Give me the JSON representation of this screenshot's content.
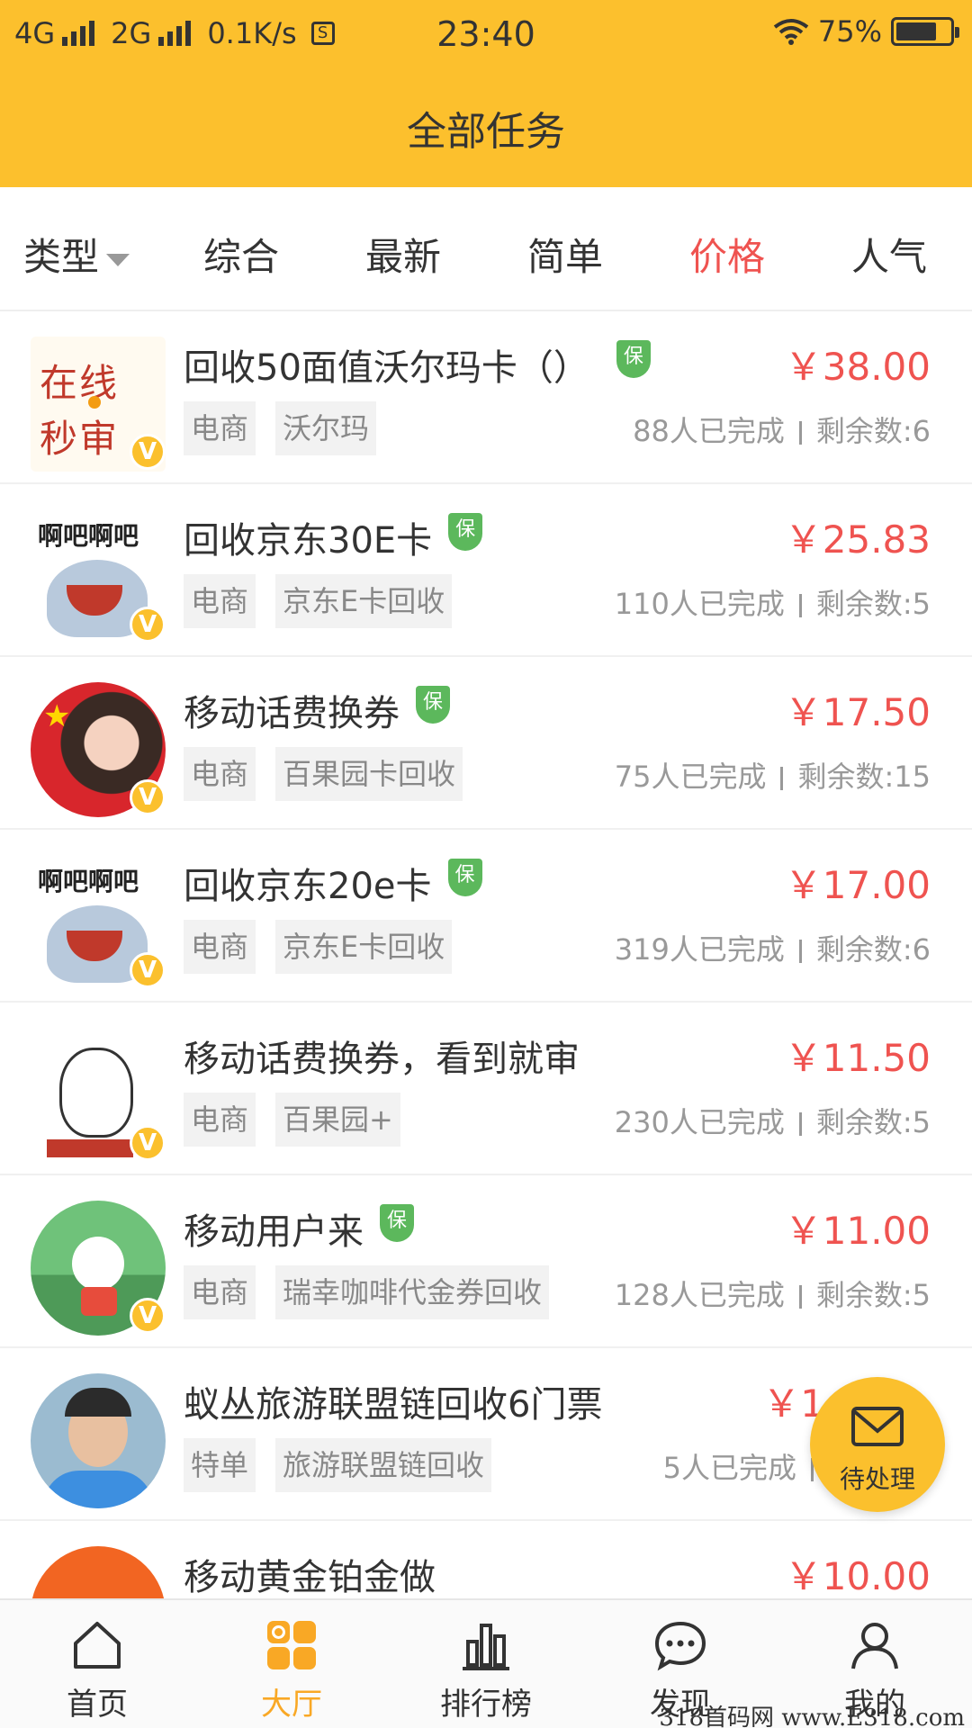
{
  "status_bar": {
    "net1": "4G",
    "net2": "2G",
    "speed": "0.1K/s",
    "time": "23:40",
    "battery": "75%",
    "battery_level": 0.75
  },
  "header": {
    "title": "全部任务"
  },
  "tabs": [
    {
      "label": "类型",
      "active": false
    },
    {
      "label": "综合",
      "active": false
    },
    {
      "label": "最新",
      "active": false
    },
    {
      "label": "简单",
      "active": false
    },
    {
      "label": "价格",
      "active": true
    },
    {
      "label": "人气",
      "active": false
    }
  ],
  "tasks": [
    {
      "title": "回收50面值沃尔玛卡（）",
      "guarantee": true,
      "price": "￥38.00",
      "tags": [
        "电商",
        "沃尔玛"
      ],
      "completed": "88人已完成",
      "remaining": "剩余数:6",
      "avatar_text": "在线秒审"
    },
    {
      "title": "回收京东30E卡",
      "guarantee": true,
      "price": "￥25.83",
      "tags": [
        "电商",
        "京东E卡回收"
      ],
      "completed": "110人已完成",
      "remaining": "剩余数:5",
      "avatar_text": "啊吧啊吧"
    },
    {
      "title": "移动话费换券",
      "guarantee": true,
      "price": "￥17.50",
      "tags": [
        "电商",
        "百果园卡回收"
      ],
      "completed": "75人已完成",
      "remaining": "剩余数:15",
      "avatar_text": ""
    },
    {
      "title": "回收京东20e卡",
      "guarantee": true,
      "price": "￥17.00",
      "tags": [
        "电商",
        "京东E卡回收"
      ],
      "completed": "319人已完成",
      "remaining": "剩余数:6",
      "avatar_text": "啊吧啊吧"
    },
    {
      "title": "移动话费换券，看到就审",
      "guarantee": false,
      "price": "￥11.50",
      "tags": [
        "电商",
        "百果园+"
      ],
      "completed": "230人已完成",
      "remaining": "剩余数:5",
      "avatar_text": ""
    },
    {
      "title": "移动用户来",
      "guarantee": true,
      "price": "￥11.00",
      "tags": [
        "电商",
        "瑞幸咖啡代金券回收"
      ],
      "completed": "128人已完成",
      "remaining": "剩余数:5",
      "avatar_text": ""
    },
    {
      "title": "蚁丛旅游联盟链回收6门票",
      "guarantee": false,
      "price": "￥1",
      "tags": [
        "特单",
        "旅游联盟链回收"
      ],
      "completed": "5人已完成",
      "remaining": "",
      "avatar_text": ""
    },
    {
      "title": "移动黄金铂金做",
      "guarantee": false,
      "price": "￥10.00",
      "tags": [],
      "completed": "",
      "remaining": "",
      "avatar_text": ""
    }
  ],
  "badges": {
    "guarantee": "保",
    "verified": "V"
  },
  "fab": {
    "label": "待处理",
    "icon": "envelope-icon"
  },
  "bottom_nav": [
    {
      "label": "首页",
      "icon": "home-icon",
      "active": false
    },
    {
      "label": "大厅",
      "icon": "grid-icon",
      "active": true
    },
    {
      "label": "排行榜",
      "icon": "bar-chart-icon",
      "active": false
    },
    {
      "label": "发现",
      "icon": "chat-bubble-icon",
      "active": false
    },
    {
      "label": "我的",
      "icon": "user-icon",
      "active": false
    }
  ],
  "watermark": "318首码网 www.E318.com",
  "colors": {
    "header": "#fcc02d",
    "accent_red": "#ef5350",
    "guarantee_green": "#5cb85c",
    "active_nav": "#f9a825"
  }
}
